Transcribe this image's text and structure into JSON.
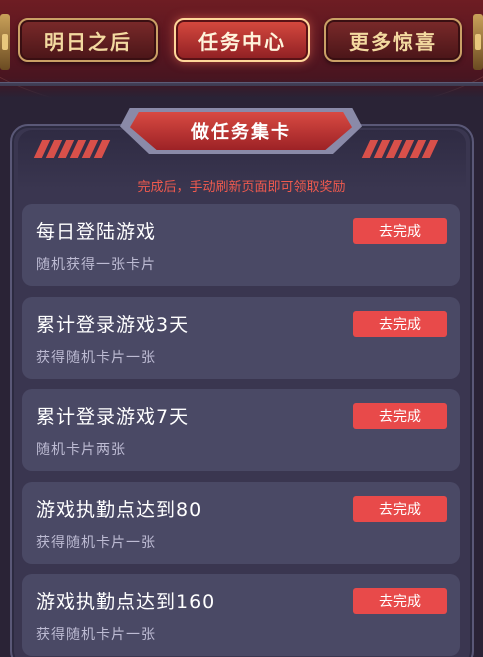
{
  "tabs": [
    {
      "label": "明日之后",
      "active": false
    },
    {
      "label": "任务中心",
      "active": true
    },
    {
      "label": "更多惊喜",
      "active": false
    }
  ],
  "panel": {
    "title": "做任务集卡",
    "hint": "完成后，手动刷新页面即可领取奖励"
  },
  "tasks": [
    {
      "title": "每日登陆游戏",
      "desc": "随机获得一张卡片",
      "button": "去完成"
    },
    {
      "title": "累计登录游戏3天",
      "desc": "获得随机卡片一张",
      "button": "去完成"
    },
    {
      "title": "累计登录游戏7天",
      "desc": "随机卡片两张",
      "button": "去完成"
    },
    {
      "title": "游戏执勤点达到80",
      "desc": "获得随机卡片一张",
      "button": "去完成"
    },
    {
      "title": "游戏执勤点达到160",
      "desc": "获得随机卡片一张",
      "button": "去完成"
    }
  ],
  "colors": {
    "accent": "#e84a4a",
    "background": "#2a2336",
    "card": "#4a4965"
  }
}
